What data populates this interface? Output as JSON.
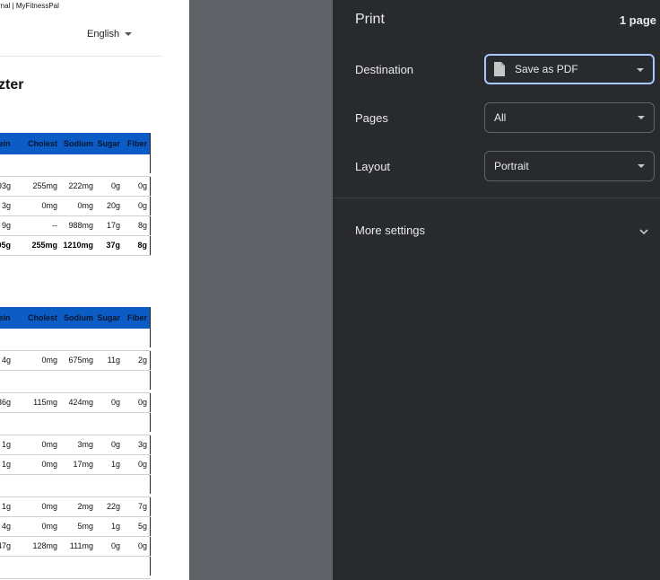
{
  "preview": {
    "header_text": "rnal | MyFitnessPal",
    "language": "English",
    "heading": "zter",
    "columns": [
      "otein",
      "Cholest",
      "Sodium",
      "Sugar",
      "Fiber"
    ],
    "table1": {
      "rows": [
        {
          "type": "blank"
        },
        {
          "type": "data",
          "cells": [
            "93g",
            "255mg",
            "222mg",
            "0g",
            "0g"
          ]
        },
        {
          "type": "data",
          "cells": [
            "3g",
            "0mg",
            "0mg",
            "20g",
            "0g"
          ]
        },
        {
          "type": "data",
          "cells": [
            "9g",
            "--",
            "988mg",
            "17g",
            "8g"
          ]
        },
        {
          "type": "total",
          "cells": [
            "105g",
            "255mg",
            "1210mg",
            "37g",
            "8g"
          ]
        }
      ]
    },
    "table2": {
      "rows": [
        {
          "type": "blank"
        },
        {
          "type": "data",
          "cells": [
            "4g",
            "0mg",
            "675mg",
            "11g",
            "2g"
          ]
        },
        {
          "type": "blank"
        },
        {
          "type": "data",
          "cells": [
            "36g",
            "115mg",
            "424mg",
            "0g",
            "0g"
          ]
        },
        {
          "type": "blank"
        },
        {
          "type": "data",
          "cells": [
            "1g",
            "0mg",
            "3mg",
            "0g",
            "3g"
          ]
        },
        {
          "type": "data",
          "cells": [
            "1g",
            "0mg",
            "17mg",
            "1g",
            "0g"
          ]
        },
        {
          "type": "blank"
        },
        {
          "type": "data",
          "cells": [
            "1g",
            "0mg",
            "2mg",
            "22g",
            "7g"
          ]
        },
        {
          "type": "data",
          "cells": [
            "4g",
            "0mg",
            "5mg",
            "1g",
            "5g"
          ]
        },
        {
          "type": "data",
          "cells": [
            "47g",
            "128mg",
            "111mg",
            "0g",
            "0g"
          ]
        },
        {
          "type": "blank"
        }
      ]
    }
  },
  "print_panel": {
    "title": "Print",
    "page_count": "1 page",
    "destination": {
      "label": "Destination",
      "value": "Save as PDF",
      "icon": "document-icon"
    },
    "pages": {
      "label": "Pages",
      "value": "All"
    },
    "layout": {
      "label": "Layout",
      "value": "Portrait"
    },
    "more_settings": {
      "label": "More settings",
      "icon": "chevron-down-icon"
    },
    "colors": {
      "panel_bg": "#292a2d",
      "focus_ring": "#a8c7fa",
      "table_header": "#0b5cc4"
    }
  }
}
